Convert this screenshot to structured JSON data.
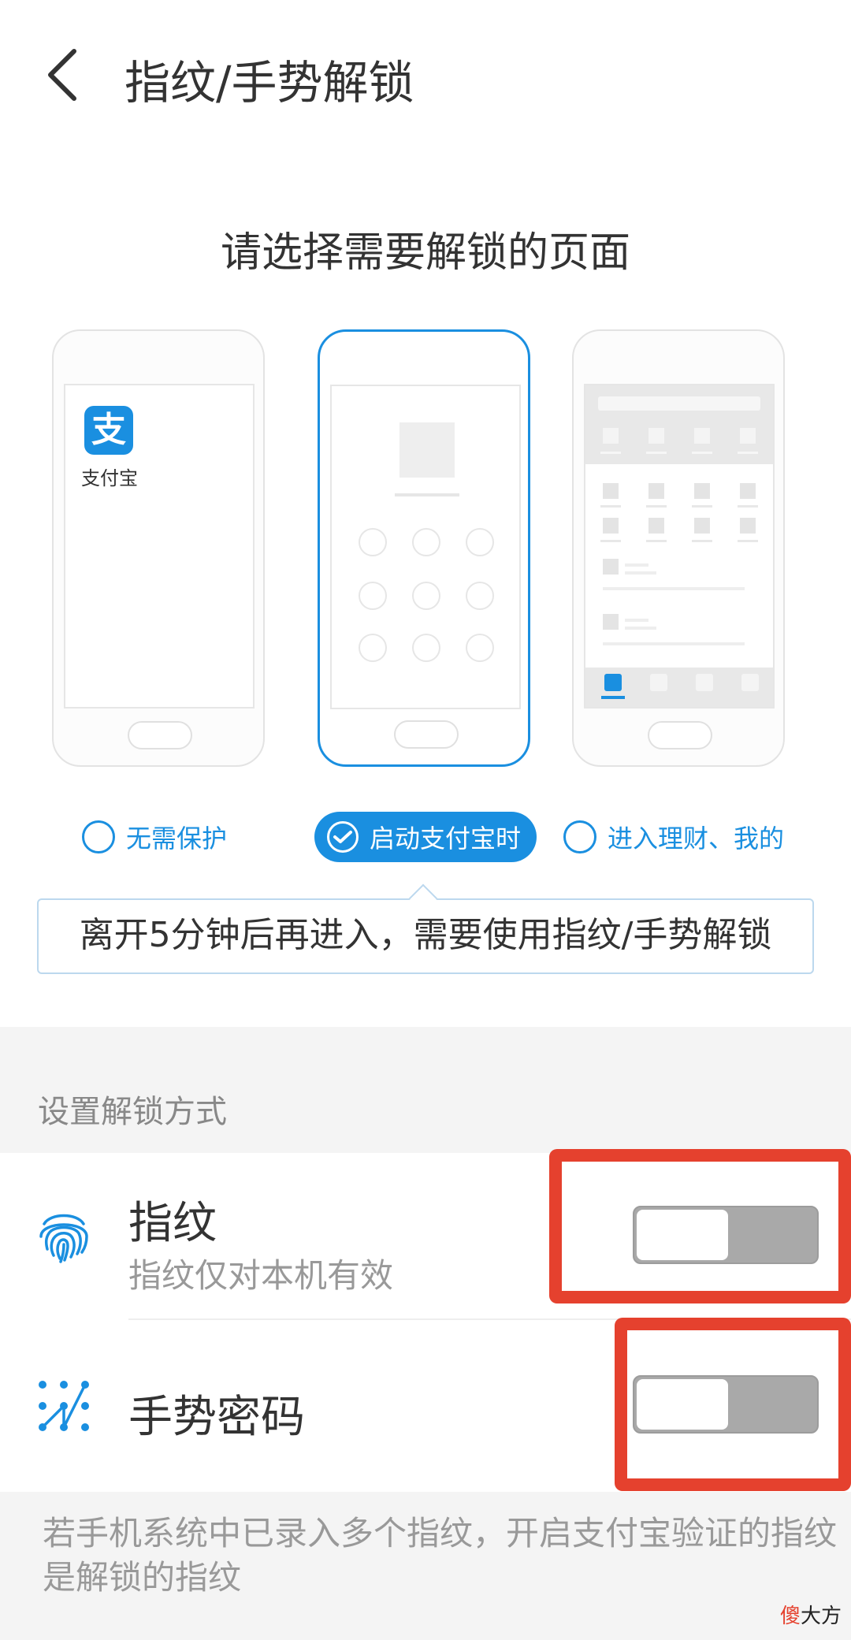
{
  "header": {
    "title": "指纹/手势解锁"
  },
  "prompt": "请选择需要解锁的页面",
  "preview": {
    "alipay_label": "支付宝",
    "alipay_glyph": "支"
  },
  "options": [
    {
      "label": "无需保护",
      "selected": false
    },
    {
      "label": "启动支付宝时",
      "selected": true
    },
    {
      "label": "进入理财、我的",
      "selected": false
    }
  ],
  "tip": "离开5分钟后再进入，需要使用指纹/手势解锁",
  "section": {
    "header": "设置解锁方式"
  },
  "fingerprint": {
    "title": "指纹",
    "subtitle": "指纹仅对本机有效",
    "enabled": false
  },
  "gesture": {
    "title": "手势密码",
    "enabled": false
  },
  "footer_note": "若手机系统中已录入多个指纹，开启支付宝验证的指纹是解锁的指纹",
  "watermark": {
    "part1": "傻",
    "part2": "大方"
  },
  "colors": {
    "accent": "#1a8fe0",
    "highlight_red": "#e5412e",
    "toggle_off": "#a9a9a9"
  }
}
